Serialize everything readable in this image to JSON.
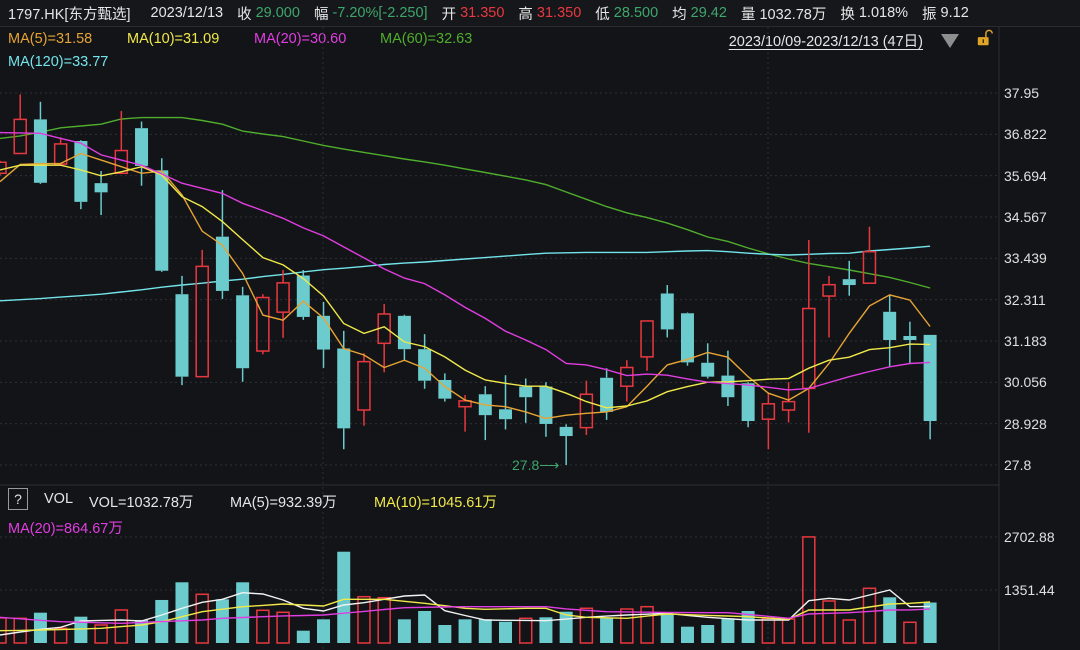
{
  "header": {
    "symbol": "1797.HK[东方甄选]",
    "date": "2023/12/13",
    "close_label": "收",
    "close": "29.000",
    "change_label": "幅",
    "change": "-7.20%[-2.250]",
    "open_label": "开",
    "open": "31.350",
    "high_label": "高",
    "high": "31.350",
    "low_label": "低",
    "low": "28.500",
    "avg_label": "均",
    "avg": "29.42",
    "volume_label": "量",
    "volume": "1032.78万",
    "turnover_label": "换",
    "turnover": "1.018%",
    "amplitude_label": "振",
    "amplitude": "9.12"
  },
  "legend": {
    "ma5": "MA(5)=31.58",
    "ma10": "MA(10)=31.09",
    "ma20": "MA(20)=30.60",
    "ma60": "MA(60)=32.63",
    "ma120": "MA(120)=33.77"
  },
  "range": "2023/10/09-2023/12/13 (47日)",
  "price_axis": [
    "37.95",
    "36.822",
    "35.694",
    "34.567",
    "33.439",
    "32.311",
    "31.183",
    "30.056",
    "28.928",
    "27.8"
  ],
  "low_marker": "27.8⟶",
  "volume_panel": {
    "help": "?",
    "title": "VOL",
    "vol": "VOL=1032.78万",
    "ma5": "MA(5)=932.39万",
    "ma10": "MA(10)=1045.61万",
    "ma20": "MA(20)=864.67万",
    "axis": [
      "2702.88",
      "1351.44"
    ]
  },
  "colors": {
    "up": "#e8383f",
    "down": "#6bcbcd",
    "ma5": "#e7a434",
    "ma10": "#f0e94a",
    "ma20": "#e03ee0",
    "ma60": "#4fae2c",
    "ma120": "#72e4ea",
    "vma5": "#f2f2f2",
    "vma10": "#f0e94a",
    "vma20": "#e03ee0"
  },
  "chart_data": [
    {
      "type": "candlestick",
      "days": 47,
      "ylim": [
        27.8,
        37.95
      ],
      "ohlc": [
        [
          35.76,
          36.1,
          35.7,
          36.06
        ],
        [
          36.3,
          37.91,
          36.3,
          37.23
        ],
        [
          37.23,
          37.71,
          35.47,
          35.5
        ],
        [
          36.01,
          36.74,
          36.01,
          36.56
        ],
        [
          36.64,
          36.66,
          34.78,
          34.98
        ],
        [
          35.49,
          35.82,
          34.62,
          35.24
        ],
        [
          35.76,
          37.46,
          35.76,
          36.38
        ],
        [
          36.99,
          37.17,
          35.42,
          35.96
        ],
        [
          35.84,
          36.17,
          33.07,
          33.1
        ],
        [
          32.46,
          32.96,
          29.98,
          30.21
        ],
        [
          30.21,
          33.67,
          30.21,
          33.22
        ],
        [
          34.03,
          35.3,
          32.33,
          32.55
        ],
        [
          32.43,
          32.66,
          30.07,
          30.44
        ],
        [
          30.91,
          32.46,
          30.82,
          32.37
        ],
        [
          31.97,
          33.12,
          31.27,
          32.77
        ],
        [
          32.97,
          33.12,
          31.76,
          31.84
        ],
        [
          31.87,
          32.25,
          30.45,
          30.95
        ],
        [
          30.98,
          31.46,
          28.23,
          28.8
        ],
        [
          29.3,
          30.85,
          28.87,
          30.62
        ],
        [
          31.12,
          32.19,
          30.33,
          31.92
        ],
        [
          31.87,
          31.9,
          30.66,
          30.96
        ],
        [
          30.96,
          31.37,
          29.88,
          30.1
        ],
        [
          30.12,
          30.3,
          29.53,
          29.61
        ],
        [
          29.39,
          29.71,
          28.71,
          29.55
        ],
        [
          29.73,
          29.95,
          28.48,
          29.16
        ],
        [
          29.32,
          30.25,
          28.77,
          29.05
        ],
        [
          29.94,
          30.16,
          28.95,
          29.65
        ],
        [
          29.94,
          30.06,
          28.57,
          28.92
        ],
        [
          28.84,
          28.91,
          27.8,
          28.59
        ],
        [
          28.82,
          30.1,
          28.62,
          29.73
        ],
        [
          30.18,
          30.44,
          29.03,
          29.25
        ],
        [
          29.95,
          30.66,
          29.53,
          30.46
        ],
        [
          30.75,
          31.73,
          30.37,
          31.73
        ],
        [
          32.48,
          32.71,
          31.28,
          31.5
        ],
        [
          31.94,
          31.96,
          30.51,
          30.6
        ],
        [
          30.59,
          31.12,
          30.16,
          30.21
        ],
        [
          30.24,
          30.92,
          29.41,
          29.65
        ],
        [
          30.03,
          30.06,
          28.83,
          29.0
        ],
        [
          29.05,
          29.78,
          28.23,
          29.47
        ],
        [
          29.3,
          30.06,
          28.96,
          29.53
        ],
        [
          29.89,
          33.94,
          28.68,
          32.07
        ],
        [
          32.41,
          32.96,
          31.28,
          32.72
        ],
        [
          32.87,
          33.37,
          32.42,
          32.71
        ],
        [
          32.76,
          34.3,
          32.76,
          33.62
        ],
        [
          31.98,
          32.44,
          30.48,
          31.21
        ],
        [
          31.32,
          31.71,
          30.57,
          31.21
        ],
        [
          31.35,
          31.35,
          28.5,
          29.0
        ]
      ],
      "series": [
        {
          "name": "MA(5)",
          "key": "ma5",
          "values": [
            35.53,
            36.0,
            36.02,
            36.03,
            36.3,
            36.12,
            35.94,
            35.76,
            35.82,
            35.17,
            34.18,
            33.8,
            33.03,
            31.89,
            31.75,
            32.27,
            31.81,
            30.98,
            30.8,
            30.46,
            30.66,
            30.44,
            29.94,
            29.57,
            29.44,
            29.39,
            29.25,
            29.07,
            29.16,
            29.21,
            29.25,
            29.39,
            29.95,
            30.53,
            30.68,
            30.87,
            30.74,
            30.21,
            29.76,
            29.57,
            29.89,
            30.57,
            31.39,
            32.14,
            32.44,
            32.3,
            31.58
          ]
        },
        {
          "name": "MA(10)",
          "key": "ma10",
          "values": [
            35.85,
            35.98,
            35.98,
            35.98,
            35.85,
            35.69,
            35.8,
            35.94,
            35.71,
            35.12,
            34.85,
            34.44,
            33.95,
            33.46,
            33.26,
            32.89,
            32.41,
            31.66,
            31.39,
            31.57,
            31.16,
            31.03,
            30.75,
            30.39,
            30.12,
            30.03,
            29.95,
            29.95,
            29.76,
            29.53,
            29.36,
            29.41,
            29.55,
            29.8,
            29.94,
            30.06,
            30.07,
            30.1,
            30.14,
            30.16,
            30.44,
            30.66,
            30.74,
            30.95,
            31.0,
            31.1,
            31.09
          ]
        },
        {
          "name": "MA(20)",
          "key": "ma20",
          "values": [
            36.87,
            36.86,
            36.85,
            36.71,
            36.58,
            36.26,
            36.12,
            35.98,
            35.74,
            35.49,
            35.35,
            35.21,
            34.94,
            34.74,
            34.53,
            34.27,
            34.05,
            33.75,
            33.45,
            33.15,
            32.9,
            32.75,
            32.44,
            32.1,
            31.8,
            31.45,
            31.21,
            30.95,
            30.57,
            30.53,
            30.4,
            30.24,
            30.28,
            30.25,
            30.15,
            30.06,
            30.02,
            29.98,
            29.92,
            29.85,
            29.89,
            30.05,
            30.21,
            30.35,
            30.48,
            30.57,
            30.6
          ]
        },
        {
          "name": "MA(60)",
          "key": "ma60",
          "values": [
            36.71,
            36.78,
            36.88,
            37.0,
            37.05,
            37.1,
            37.24,
            37.28,
            37.28,
            37.28,
            37.2,
            37.1,
            36.91,
            36.83,
            36.76,
            36.64,
            36.52,
            36.42,
            36.33,
            36.24,
            36.15,
            36.07,
            35.98,
            35.88,
            35.78,
            35.68,
            35.58,
            35.45,
            35.25,
            35.05,
            34.85,
            34.68,
            34.55,
            34.4,
            34.22,
            34.02,
            33.9,
            33.72,
            33.56,
            33.42,
            33.3,
            33.21,
            33.12,
            33.02,
            32.92,
            32.78,
            32.63
          ]
        },
        {
          "name": "MA(120)",
          "key": "ma120",
          "values": [
            32.28,
            32.31,
            32.34,
            32.38,
            32.42,
            32.46,
            32.52,
            32.58,
            32.65,
            32.71,
            32.76,
            32.82,
            32.87,
            32.94,
            33.0,
            33.07,
            33.13,
            33.17,
            33.22,
            33.27,
            33.31,
            33.34,
            33.38,
            33.42,
            33.46,
            33.5,
            33.54,
            33.58,
            33.59,
            33.6,
            33.6,
            33.6,
            33.6,
            33.62,
            33.64,
            33.65,
            33.62,
            33.58,
            33.55,
            33.53,
            33.55,
            33.57,
            33.58,
            33.64,
            33.68,
            33.72,
            33.77
          ]
        }
      ]
    },
    {
      "type": "bar",
      "unit": "万",
      "ylim": [
        0,
        2702.88
      ],
      "volume": [
        640,
        630,
        773,
        375,
        671,
        459,
        842,
        587,
        1097,
        1548,
        1242,
        1114,
        1548,
        834,
        783,
        314,
        604,
        2328,
        1181,
        1155,
        604,
        816,
        459,
        604,
        604,
        543,
        630,
        655,
        798,
        885,
        630,
        867,
        926,
        740,
        416,
        459,
        630,
        816,
        630,
        612,
        2705,
        1071,
        587,
        1395,
        1165,
        528,
        1032.78
      ],
      "up": [
        1,
        1,
        0,
        1,
        0,
        1,
        1,
        0,
        0,
        0,
        1,
        0,
        0,
        1,
        1,
        0,
        0,
        0,
        1,
        1,
        0,
        0,
        0,
        0,
        0,
        0,
        1,
        0,
        0,
        1,
        0,
        1,
        1,
        0,
        0,
        0,
        0,
        0,
        1,
        1,
        1,
        1,
        1,
        1,
        0,
        1,
        0
      ],
      "series": [
        {
          "name": "MA(5)",
          "key": "vma5",
          "values": [
            204,
            280,
            349,
            400,
            561,
            575,
            587,
            561,
            714,
            885,
            1038,
            1114,
            1283,
            1250,
            1097,
            885,
            816,
            969,
            1028,
            1114,
            1199,
            1224,
            824,
            700,
            587,
            580,
            575,
            569,
            610,
            655,
            685,
            714,
            735,
            757,
            705,
            655,
            620,
            587,
            587,
            587,
            1079,
            1140,
            1097,
            1224,
            1351,
            926,
            932.39
          ]
        },
        {
          "name": "MA(10)",
          "key": "vma10",
          "values": [
            314,
            322,
            332,
            345,
            360,
            375,
            417,
            459,
            543,
            670,
            798,
            862,
            926,
            960,
            995,
            970,
            944,
            1114,
            1114,
            1114,
            1063,
            1012,
            950,
            885,
            860,
            872,
            885,
            885,
            714,
            655,
            642,
            630,
            685,
            740,
            722,
            705,
            688,
            671,
            637,
            604,
            841,
            841,
            841,
            918,
            995,
            1012,
            1045.61
          ]
        },
        {
          "name": "MA(20)",
          "key": "vma20",
          "values": [
            655,
            618,
            580,
            543,
            530,
            515,
            502,
            523,
            545,
            566,
            587,
            630,
            650,
            671,
            690,
            702,
            714,
            760,
            805,
            855,
            901,
            910,
            918,
            926,
            926,
            926,
            926,
            926,
            870,
            835,
            798,
            792,
            786,
            780,
            776,
            773,
            773,
            730,
            680,
            630,
            740,
            757,
            773,
            807,
            841,
            845,
            864.67
          ]
        }
      ]
    }
  ]
}
